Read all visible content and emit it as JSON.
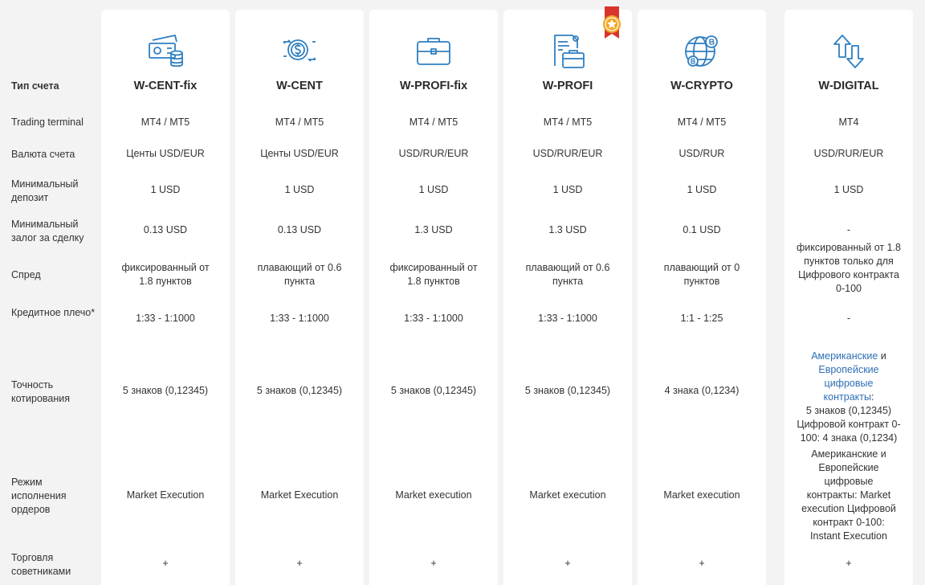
{
  "labels": {
    "account_type": "Тип счета",
    "terminal": "Trading terminal",
    "currency": "Валюта счета",
    "min_deposit": "Минимальный депозит",
    "min_margin": "Минимальный залог за сделку",
    "spread": "Спред",
    "leverage": "Кредитное плечо*",
    "precision": "Точность котирования",
    "execution": "Режим исполнения ордеров",
    "advisors": "Торговля советниками"
  },
  "accounts": [
    {
      "name": "W-CENT-fix",
      "icon": "money-coins-icon",
      "terminal": "MT4 / MT5",
      "currency": "Центы USD/EUR",
      "min_deposit": "1 USD",
      "min_margin": "0.13 USD",
      "spread": "фиксированный от 1.8 пунктов",
      "leverage": "1:33 - 1:1000",
      "precision": "5 знаков (0,12345)",
      "execution": "Market Execution",
      "advisors": "+"
    },
    {
      "name": "W-CENT",
      "icon": "coins-exchange-icon",
      "terminal": "MT4 / MT5",
      "currency": "Центы USD/EUR",
      "min_deposit": "1 USD",
      "min_margin": "0.13 USD",
      "spread": "плавающий от 0.6 пункта",
      "leverage": "1:33 - 1:1000",
      "precision": "5 знаков (0,12345)",
      "execution": "Market Execution",
      "advisors": "+"
    },
    {
      "name": "W-PROFI-fix",
      "icon": "briefcase-icon",
      "terminal": "MT4 / MT5",
      "currency": "USD/RUR/EUR",
      "min_deposit": "1 USD",
      "min_margin": "1.3 USD",
      "spread": "фиксированный от 1.8 пунктов",
      "leverage": "1:33 - 1:1000",
      "precision": "5 знаков (0,12345)",
      "execution": "Market execution",
      "advisors": "+"
    },
    {
      "name": "W-PROFI",
      "icon": "briefcase-document-icon",
      "terminal": "MT4 / MT5",
      "currency": "USD/RUR/EUR",
      "min_deposit": "1 USD",
      "min_margin": "1.3 USD",
      "spread": "плавающий от 0.6 пункта",
      "leverage": "1:33 - 1:1000",
      "precision": "5 знаков (0,12345)",
      "execution": "Market execution",
      "advisors": "+"
    },
    {
      "name": "W-CRYPTO",
      "icon": "globe-bitcoin-icon",
      "terminal": "MT4 / MT5",
      "currency": "USD/RUR",
      "min_deposit": "1 USD",
      "min_margin": "0.1 USD",
      "spread": "плавающий от 0 пунктов",
      "leverage": "1:1 - 1:25",
      "precision": "4 знака (0,1234)",
      "execution": "Market execution",
      "advisors": "+"
    }
  ],
  "digital": {
    "name": "W-DIGITAL",
    "icon": "arrows-up-down-icon",
    "terminal": "MT4",
    "currency": "USD/RUR/EUR",
    "min_deposit": "1 USD",
    "min_margin": "-",
    "spread": "фиксированный от 1.8 пунктов только для Цифрового контракта 0-100",
    "leverage": "-",
    "precision_link1": "Американские",
    "precision_and": " и ",
    "precision_link2": "Европейские цифровые контракты",
    "precision_rest1": ":",
    "precision_rest2": "5 знаков (0,12345)",
    "precision_rest3": "Цифровой контракт 0-100: 4 знака (0,1234)",
    "execution": "Американские и Европейские цифровые контракты: Market execution Цифровой контракт 0-100: Instant Execution",
    "advisors": "+"
  },
  "colors": {
    "icon_blue": "#2f7fc1",
    "link": "#2f6fb5",
    "badge": "#f5a623",
    "badge_ribbon": "#d9342b"
  }
}
